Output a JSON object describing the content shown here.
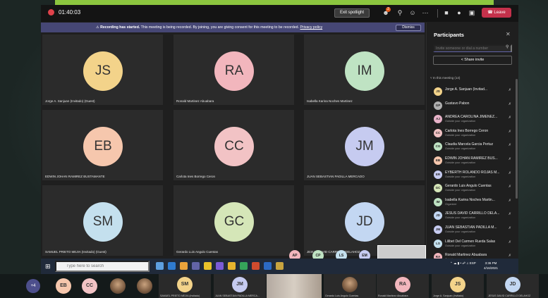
{
  "meeting": {
    "timer": "01:40:03",
    "exit_spotlight": "Exit spotlight",
    "leave": "Leave",
    "notification_count": "2"
  },
  "banner": {
    "bold": "Recording has started.",
    "text": "This meeting is being recorded. By joining, you are giving consent for this meeting to be recorded.",
    "link": "Privacy policy",
    "dismiss": "Dismiss"
  },
  "tiles": [
    {
      "initials": "JS",
      "name": "Jorge A. Sanjuan (Invitado) (Guest)",
      "color": "#f3d38a"
    },
    {
      "initials": "RA",
      "name": "Ronald Martinez Abuabara",
      "color": "#f2b6bd"
    },
    {
      "initials": "IM",
      "name": "Isabella Karina Noches Martinez",
      "color": "#bfe3c3"
    },
    {
      "initials": "EB",
      "name": "EDWIN JOHAN RAMIREZ BUSTAMANTE",
      "color": "#f6c7ad"
    },
    {
      "initials": "CC",
      "name": "Carlota Ines Borrego Ceron",
      "color": "#f2c3c5"
    },
    {
      "initials": "JM",
      "name": "JUAN SEBASTIAN PADILLA MERCADO",
      "color": "#c6cbf0"
    },
    {
      "initials": "SM",
      "name": "SAMUEL PRIETO MEJIA (Invitado) (Guest)",
      "color": "#c4e0ee"
    },
    {
      "initials": "GC",
      "name": "Gerardo Luis Angulo Cuentas",
      "color": "#d5e6b8"
    },
    {
      "initials": "JD",
      "name": "JESUS DAVID CARRILLO DELAHOZ",
      "color": "#c3d7f2"
    }
  ],
  "participants": {
    "title": "Participants",
    "invite_placeholder": "Invite someone or dial a number",
    "share_invite": "Share invite",
    "section": "In this meeting (14)",
    "list": [
      {
        "initials": "JS",
        "name": "Jorge A. Sanjuan (Invitad...",
        "sub": "",
        "color": "#f3d38a"
      },
      {
        "initials": "GP",
        "name": "Gustavo Pabon",
        "sub": "",
        "color": "#b0b0b0"
      },
      {
        "initials": "AJ",
        "name": "ANDREA CAROLINA JIMENEZ...",
        "sub": "Outside your organization",
        "color": "#e8b3c9"
      },
      {
        "initials": "CC",
        "name": "Carlota Ines Borrego Ceron",
        "sub": "Outside your organization",
        "color": "#f2c3c5"
      },
      {
        "initials": "CG",
        "name": "Claudia Marcela Garcia Pertuz",
        "sub": "Outside your organization",
        "color": "#bfe3c3"
      },
      {
        "initials": "EB",
        "name": "EDWIN JOHAN RAMIREZ BUS...",
        "sub": "Outside your organization",
        "color": "#f6c7ad"
      },
      {
        "initials": "ER",
        "name": "EYBERTH ROLANDO ROJAS M...",
        "sub": "Outside your organization",
        "color": "#c6cbf0"
      },
      {
        "initials": "GC",
        "name": "Gerardo Luis Angulo Cuentas",
        "sub": "Outside your organization",
        "color": "#d5e6b8"
      },
      {
        "initials": "IM",
        "name": "Isabella Karina Noches Martin...",
        "sub": "Organizer",
        "color": "#bfe3c3"
      },
      {
        "initials": "JD",
        "name": "JESUS DAVID CARRILLO DELA...",
        "sub": "Outside your organization",
        "color": "#c3d7f2"
      },
      {
        "initials": "JM",
        "name": "JUAN SEBASTIAN PADILLA M...",
        "sub": "Outside your organization",
        "color": "#c6cbf0"
      },
      {
        "initials": "LS",
        "name": "Lilibet Del Carmen Rueda Salas",
        "sub": "Outside your organization",
        "color": "#c4e0ee"
      },
      {
        "initials": "RA",
        "name": "Ronald Martinez Abuabara",
        "sub": "Outside your organization",
        "color": "#f2b6bd"
      }
    ]
  },
  "taskbar": {
    "search_placeholder": "Type here to search",
    "lang": "ESP",
    "time": "3:36 PM",
    "date": "4/16/2021"
  },
  "strip": [
    {
      "initials": "AP",
      "color": "#f2b6bd"
    },
    {
      "initials": "CP",
      "color": "#bfe3c3"
    },
    {
      "initials": "LS",
      "color": "#c4e0ee"
    },
    {
      "initials": "EM",
      "color": "#c6cbf0"
    }
  ],
  "bottom": {
    "more": "+4",
    "small": [
      {
        "initials": "EB",
        "color": "#f6c7ad"
      },
      {
        "initials": "CC",
        "color": "#f2c3c5"
      }
    ],
    "tiles": [
      {
        "initials": "SM",
        "name": "SAMUEL PRIETO MEJIA (Invitado)",
        "color": "#f3d38a"
      },
      {
        "initials": "JM",
        "name": "JUAN SEBASTIAN PADILLA MERCA...",
        "color": "#c6cbf0"
      },
      {
        "initials": "",
        "name": "Gerardo Luis Angulo Cuentas",
        "color": "#2a2a2a"
      },
      {
        "initials": "RA",
        "name": "Ronald Martinez Abuabara",
        "color": "#f2b6bd"
      },
      {
        "initials": "JS",
        "name": "Jorge A. Sanjuan (Invitado)",
        "color": "#f3d38a"
      },
      {
        "initials": "JD",
        "name": "JESUS DAVID CARRILLO DELAHOZ",
        "color": "#c3d7f2"
      }
    ]
  }
}
